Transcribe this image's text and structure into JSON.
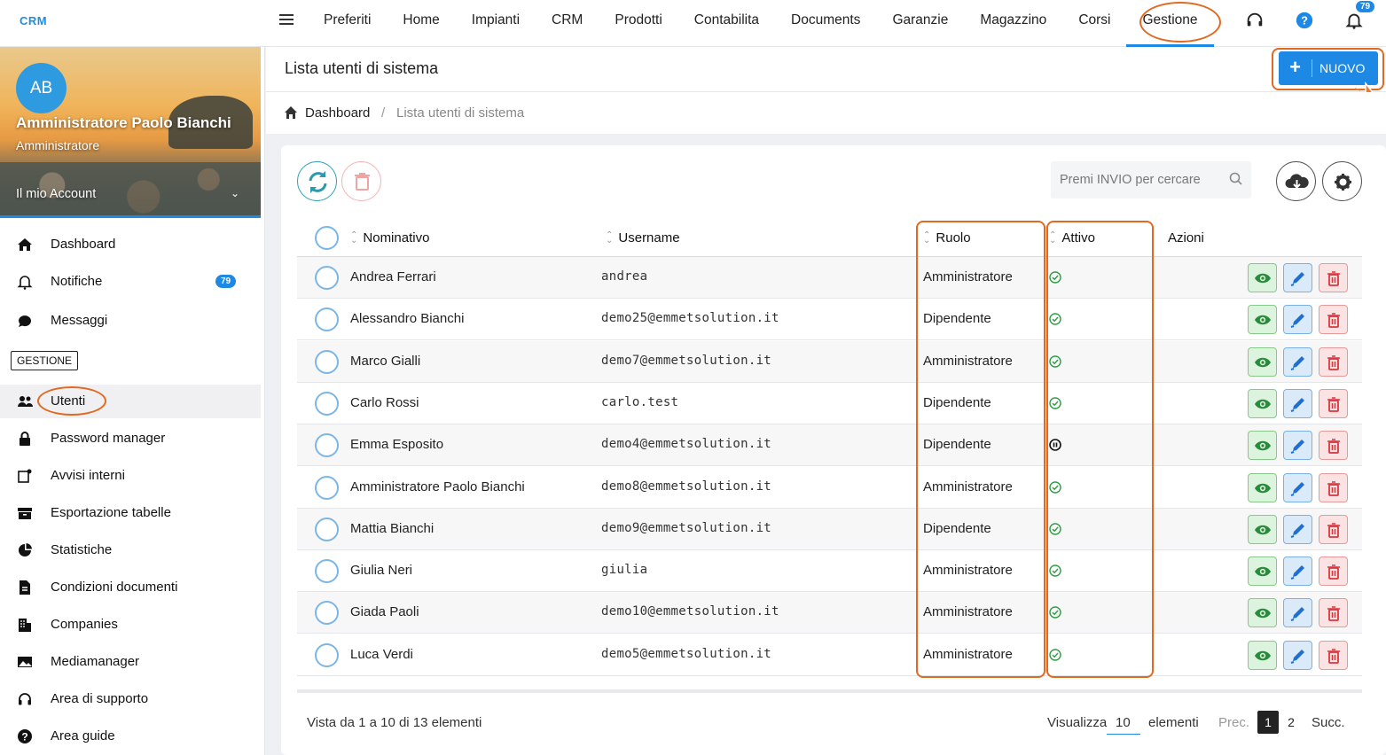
{
  "app": {
    "brand": "CRM"
  },
  "topnav": {
    "items": [
      "Preferiti",
      "Home",
      "Impianti",
      "CRM",
      "Prodotti",
      "Contabilita",
      "Documents",
      "Garanzie",
      "Magazzino",
      "Corsi",
      "Gestione"
    ],
    "active": "Gestione",
    "notifications_badge": "79",
    "icons": [
      "headset-icon",
      "help-icon",
      "bell-icon"
    ]
  },
  "profile": {
    "initials": "AB",
    "name": "Amministratore Paolo Bianchi",
    "role": "Amministratore",
    "account_label": "Il mio Account"
  },
  "sidebar": {
    "top_items": [
      {
        "label": "Dashboard",
        "icon": "home-icon"
      },
      {
        "label": "Notifiche",
        "icon": "bell-icon",
        "badge": "79"
      },
      {
        "label": "Messaggi",
        "icon": "chat-icon"
      }
    ],
    "section_label": "GESTIONE",
    "items": [
      {
        "label": "Utenti",
        "icon": "users-icon",
        "active": true
      },
      {
        "label": "Password manager",
        "icon": "lock-icon"
      },
      {
        "label": "Avvisi interni",
        "icon": "notice-icon"
      },
      {
        "label": "Esportazione tabelle",
        "icon": "archive-icon"
      },
      {
        "label": "Statistiche",
        "icon": "pie-chart-icon"
      },
      {
        "label": "Condizioni documenti",
        "icon": "document-icon"
      },
      {
        "label": "Companies",
        "icon": "building-icon"
      },
      {
        "label": "Mediamanager",
        "icon": "image-icon"
      },
      {
        "label": "Area di supporto",
        "icon": "headset-icon"
      },
      {
        "label": "Area guide",
        "icon": "help-icon"
      }
    ]
  },
  "page": {
    "title": "Lista utenti di sistema",
    "new_button": "NUOVO",
    "breadcrumb": [
      "Dashboard",
      "Lista utenti di sistema"
    ]
  },
  "toolbar": {
    "search_placeholder": "Premi INVIO per cercare"
  },
  "table": {
    "columns": [
      "Nominativo",
      "Username",
      "Ruolo",
      "Attivo",
      "Azioni"
    ],
    "rows": [
      {
        "name": "Andrea Ferrari",
        "username": "andrea",
        "role": "Amministratore",
        "active": "check"
      },
      {
        "name": "Alessandro Bianchi",
        "username": "demo25@emmetsolution.it",
        "role": "Dipendente",
        "active": "check"
      },
      {
        "name": "Marco Gialli",
        "username": "demo7@emmetsolution.it",
        "role": "Amministratore",
        "active": "check"
      },
      {
        "name": "Carlo Rossi",
        "username": "carlo.test",
        "role": "Dipendente",
        "active": "check"
      },
      {
        "name": "Emma Esposito",
        "username": "demo4@emmetsolution.it",
        "role": "Dipendente",
        "active": "paused"
      },
      {
        "name": "Amministratore Paolo Bianchi",
        "username": "demo8@emmetsolution.it",
        "role": "Amministratore",
        "active": "check"
      },
      {
        "name": "Mattia Bianchi",
        "username": "demo9@emmetsolution.it",
        "role": "Dipendente",
        "active": "check"
      },
      {
        "name": "Giulia Neri",
        "username": "giulia",
        "role": "Amministratore",
        "active": "check"
      },
      {
        "name": "Giada Paoli",
        "username": "demo10@emmetsolution.it",
        "role": "Amministratore",
        "active": "check"
      },
      {
        "name": "Luca Verdi",
        "username": "demo5@emmetsolution.it",
        "role": "Amministratore",
        "active": "check"
      }
    ]
  },
  "footer": {
    "info": "Vista da 1 a 10 di 13 elementi",
    "show_label": "Visualizza",
    "page_size": "10",
    "elements_label": "elementi",
    "prev": "Prec.",
    "pages": [
      "1",
      "2"
    ],
    "current_page": "1",
    "next": "Succ."
  },
  "colors": {
    "accent": "#1e88e5",
    "highlight": "#e06a22",
    "success": "#2e9e46",
    "danger": "#d9363e"
  }
}
